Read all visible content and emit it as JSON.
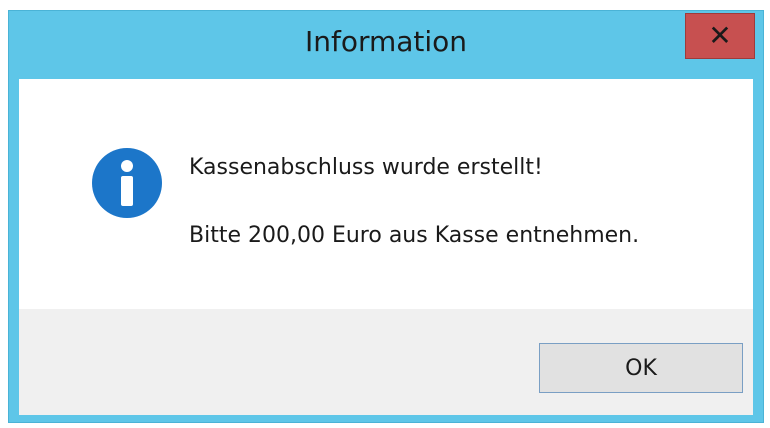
{
  "window": {
    "title": "Information",
    "close_icon": "close-icon"
  },
  "message": {
    "icon": "info-icon",
    "line1": "Kassenabschluss wurde erstellt!",
    "line2": "Bitte 200,00 Euro aus Kasse entnehmen."
  },
  "footer": {
    "ok_label": "OK"
  },
  "colors": {
    "titlebar": "#5ec6e8",
    "close_button": "#c75050",
    "info_icon": "#1c76c9",
    "content_bg": "#ffffff",
    "footer_bg": "#f0f0f0"
  }
}
